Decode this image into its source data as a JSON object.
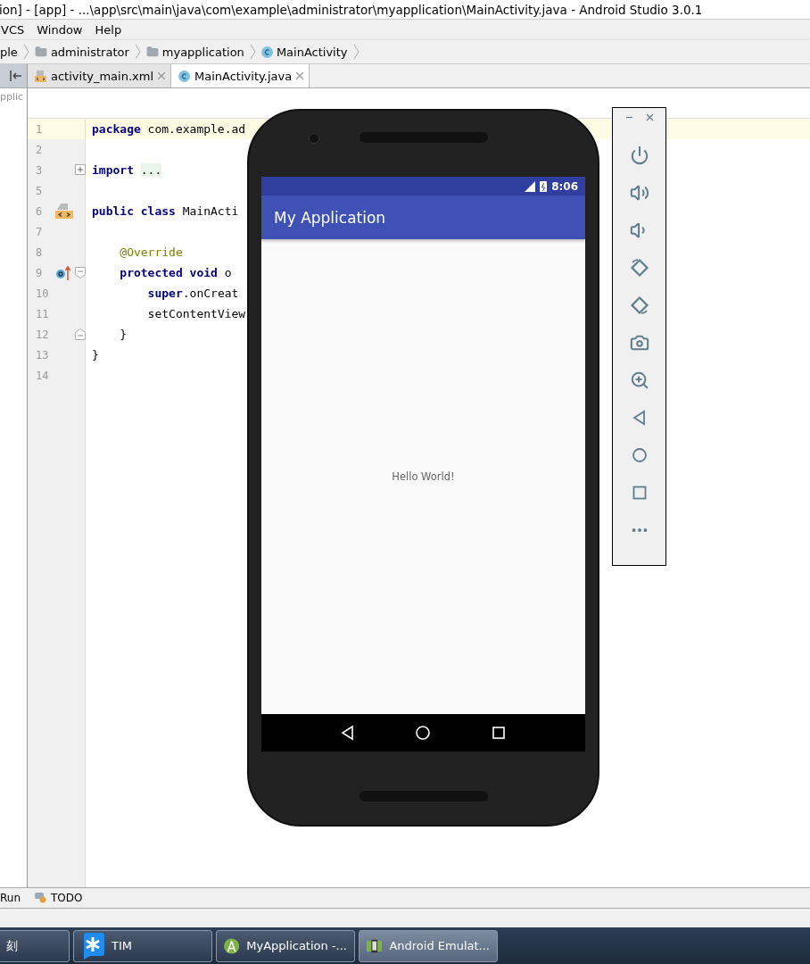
{
  "window": {
    "title": "ion] - [app] - ...\\app\\src\\main\\java\\com\\example\\administrator\\myapplication\\MainActivity.java - Android Studio 3.0.1"
  },
  "menu": [
    {
      "label": "VCS"
    },
    {
      "label": "Window"
    },
    {
      "label": "Help"
    }
  ],
  "breadcrumbs": [
    {
      "label": "ple",
      "kind": "text"
    },
    {
      "label": "administrator",
      "kind": "folder"
    },
    {
      "label": "myapplication",
      "kind": "folder"
    },
    {
      "label": "MainActivity",
      "kind": "class"
    }
  ],
  "tabs": [
    {
      "label": "activity_main.xml",
      "kind": "xml",
      "selected": false
    },
    {
      "label": "MainActivity.java",
      "kind": "class",
      "selected": true
    }
  ],
  "project_pane": {
    "label": "pplic"
  },
  "editor": {
    "lines": [
      {
        "number": "1",
        "current": true,
        "tokens": [
          {
            "text": "package",
            "kind": "keyword"
          },
          {
            "text": "com.example.ad",
            "kind": "plain"
          }
        ]
      },
      {
        "number": "2",
        "current": false
      },
      {
        "number": "3",
        "current": false,
        "fold": {
          "kind": "collapsed"
        },
        "tokens": [
          {
            "text": "import",
            "kind": "keyword"
          },
          {
            "text": "...",
            "kind": "folded"
          }
        ]
      },
      {
        "number": "5",
        "current": false
      },
      {
        "number": "6",
        "current": false,
        "gutter_icon": {
          "kind": "layout"
        },
        "tokens": [
          {
            "text": "public class",
            "kind": "keyword"
          },
          {
            "text": "MainActi",
            "kind": "plain"
          }
        ]
      },
      {
        "number": "7",
        "current": false
      },
      {
        "number": "8",
        "current": false,
        "tokens": [
          {
            "text": "    @Override",
            "kind": "annotation"
          }
        ]
      },
      {
        "number": "9",
        "current": false,
        "gutter_icon": {
          "kind": "override"
        },
        "fold": {
          "kind": "start"
        },
        "tokens": [
          {
            "text": "    protected void",
            "kind": "keyword"
          },
          {
            "text": "o",
            "kind": "plain"
          }
        ]
      },
      {
        "number": "10",
        "current": false,
        "tokens": [
          {
            "text": "        super",
            "kind": "keyword"
          },
          {
            "text": ".onCreat",
            "kind": "member"
          }
        ]
      },
      {
        "number": "11",
        "current": false,
        "tokens": [
          {
            "text": "        setContentView",
            "kind": "plain"
          }
        ]
      },
      {
        "number": "12",
        "current": false,
        "fold": {
          "kind": "end"
        },
        "tokens": [
          {
            "text": "    }",
            "kind": "plain"
          }
        ]
      },
      {
        "number": "13",
        "current": false,
        "tokens": [
          {
            "text": "}",
            "kind": "plain"
          }
        ]
      },
      {
        "number": "14",
        "current": false
      }
    ]
  },
  "emulator": {
    "status_time": "8:06",
    "app_title": "My Application",
    "content": "Hello World!"
  },
  "tool_windows": [
    {
      "label": "Run",
      "kind": "run"
    },
    {
      "label": "TODO",
      "kind": "todo"
    }
  ],
  "taskbar": [
    {
      "label": "刻",
      "kind": "plain",
      "selected": false
    },
    {
      "label": "TIM",
      "kind": "tim",
      "selected": false
    },
    {
      "label": "MyApplication -...",
      "kind": "studio",
      "selected": false
    },
    {
      "label": "Android Emulat...",
      "kind": "emulator",
      "selected": true
    }
  ]
}
